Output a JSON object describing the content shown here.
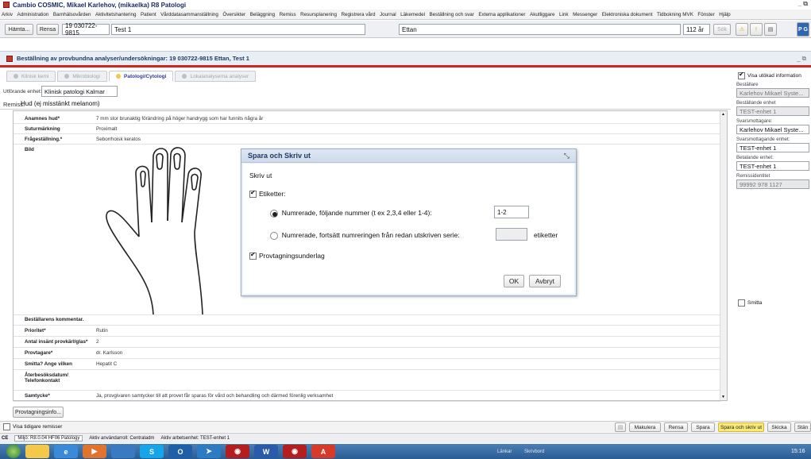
{
  "app": {
    "title": "Cambio COSMIC, Mikael  Karlehov, (mikaelka) R8 Patologi",
    "window_controls": "_ ⧉"
  },
  "menu": [
    "Arkiv",
    "Administration",
    "Barnhälsovården",
    "Aktivitetshantering",
    "Patient",
    "Vårddatasammanställning",
    "Översikter",
    "Beläggning",
    "Remiss",
    "Resursplanering",
    "Registrera vård",
    "Journal",
    "Läkemedel",
    "Beställning och svar",
    "Externa applikationer",
    "Akutliggare",
    "Link",
    "Messenger",
    "Elektroniska dokument",
    "Tidbokning MVK",
    "Fönster",
    "Hjälp"
  ],
  "toolbar": {
    "hamta": "Hämta...",
    "rensa": "Rensa",
    "pnr": "19 030722-9815",
    "name": "Test 1",
    "unit": "Ettan",
    "age": "112 år",
    "sok": "Sök"
  },
  "order_header": "Beställning av provbundna analyser/undersökningar: 19 030722-9815 Ettan, Test 1",
  "tabs": [
    {
      "label": "Klinisk kemi",
      "active": false
    },
    {
      "label": "Mikrobiologi",
      "active": false
    },
    {
      "label": "Patologi/Cytologi",
      "active": true
    },
    {
      "label": "Lokalanalyserna analyser",
      "active": false
    }
  ],
  "unit": {
    "label": "Utförande enhet:",
    "value": "Klinisk patologi Kalmar"
  },
  "remiss": {
    "label": "Remiss:",
    "value": "Hud (ej misstänkt melanom)"
  },
  "form_top": [
    {
      "k": "Anamnes hud*",
      "v": "7 mm stor brunaktig förändring på höger handrygg som har funnits några år"
    },
    {
      "k": "Suturmärkning",
      "v": "Proximalt"
    },
    {
      "k": "Frågeställning.*",
      "v": "Seborrhoisk keratos"
    },
    {
      "k": "Bild",
      "v": ""
    }
  ],
  "form_bottom": [
    {
      "k": "Beställarens kommentar.",
      "v": ""
    },
    {
      "k": "Prioritet*",
      "v": "Rutin"
    },
    {
      "k": "Antal insänt provkärl/glas*",
      "v": "2"
    },
    {
      "k": "Provtagare*",
      "v": "dr. Karlsson"
    },
    {
      "k": "Smitta? Ange vilken",
      "v": "Hepatit C"
    },
    {
      "k": "Återbesöksdatum/ Telefonkontakt",
      "v": ""
    },
    {
      "k": "Samtycke*",
      "v": "Ja, provgivaren samtycker till att provet får sparas för vård och behandling och därmed förenlig verksamhet"
    }
  ],
  "provtagningsinfo": "Provtagningsinfo...",
  "right": {
    "show_info": "Visa utökad information",
    "fields": [
      {
        "label": "Beställare",
        "value": "Karlehov Mikael Syste...",
        "grey": true
      },
      {
        "label": "Beställande enhet",
        "value": "TEST-enhet 1",
        "grey": true
      },
      {
        "label": "Svarsmottagare:",
        "value": "Karlehov Mikael Syste...",
        "grey": false
      },
      {
        "label": "Svarsmottagande enhet:",
        "value": "TEST-enhet 1",
        "grey": false
      },
      {
        "label": "Betalande enhet:",
        "value": "TEST-enhet 1",
        "grey": false
      },
      {
        "label": "Remissidentitet",
        "value": "99992 978 1127",
        "grey": true
      }
    ],
    "smitta": "Smitta"
  },
  "dialog": {
    "title": "Spara och Skriv ut",
    "section": "Skriv ut",
    "etiketter": "Etiketter:",
    "opt1": "Numrerade, följande nummer (t ex 2,3,4 eller 1-4):",
    "opt1_value": "1-2",
    "opt2": "Numrerade, fortsätt numreringen från redan utskriven serie:",
    "opt2_suffix": "etiketter",
    "provtagningsunderlag": "Provtagningsunderlag",
    "ok": "OK",
    "cancel": "Avbryt"
  },
  "bottom": {
    "visa_tidigare": "Visa tidigare remisser",
    "makulera": "Makulera",
    "rensa": "Rensa",
    "spara": "Spara",
    "spara_skriv": "Spara och skriv ut",
    "skicka": "Skicka",
    "stang": "Stän"
  },
  "status": {
    "miljo": "Miljö: R8.0.04 HF06 Patology",
    "anv": "Aktiv användarroll: Centraladm",
    "enhet": "Aktiv arbetsenhet: TEST-enhet 1"
  },
  "taskbar": {
    "lankar": "Länkar",
    "skrivbord": "Skrivbord",
    "time": "15:16"
  }
}
